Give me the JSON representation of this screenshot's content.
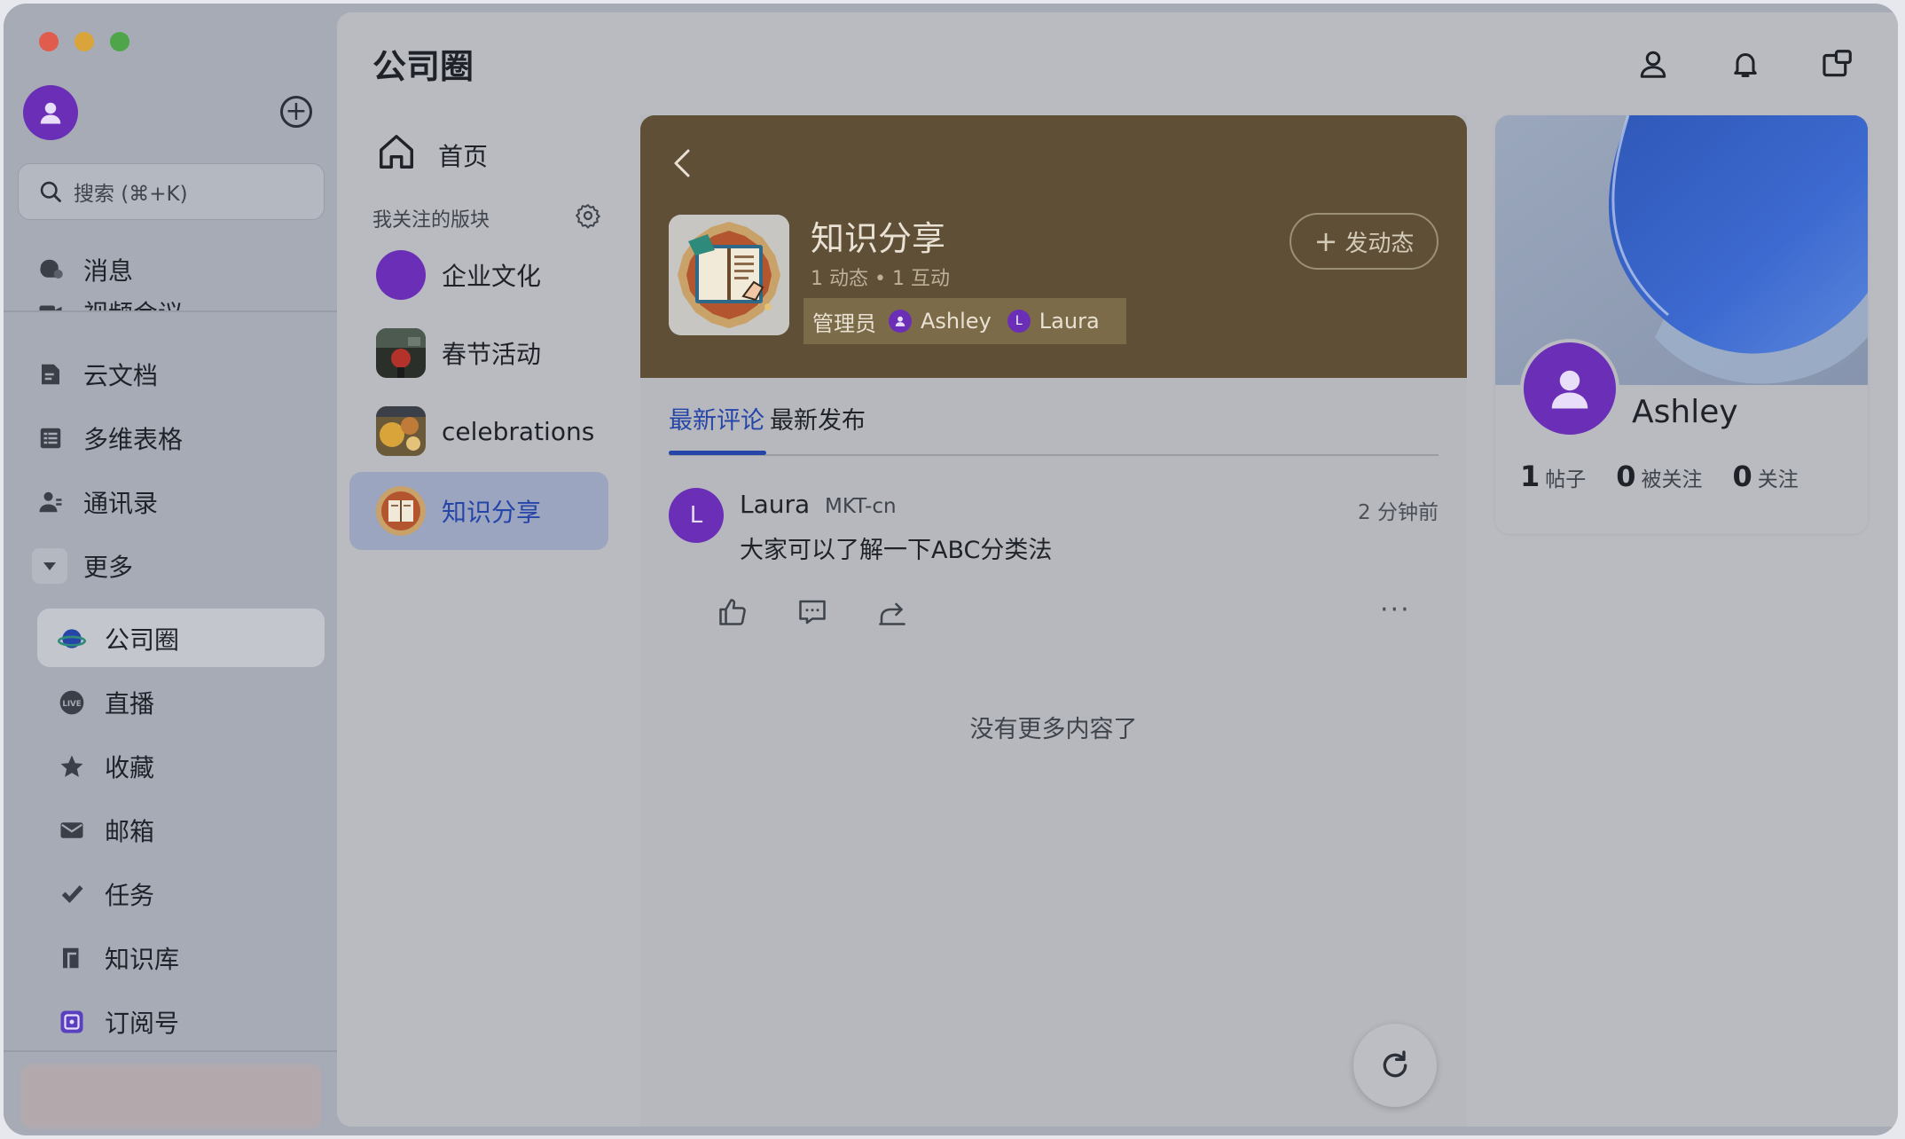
{
  "app": {
    "title": "公司圈"
  },
  "sidebar": {
    "search_placeholder": "搜索 (⌘+K)",
    "items": [
      {
        "label": "消息",
        "icon": "chat-icon"
      },
      {
        "label": "视频会议",
        "icon": "video-icon"
      },
      {
        "label": "云文档",
        "icon": "doc-icon"
      },
      {
        "label": "多维表格",
        "icon": "table-icon"
      },
      {
        "label": "通讯录",
        "icon": "contacts-icon"
      },
      {
        "label": "更多",
        "icon": "chevron-down-icon"
      }
    ],
    "sub_items": [
      {
        "label": "公司圈",
        "icon": "planet-icon"
      },
      {
        "label": "直播",
        "icon": "live-icon"
      },
      {
        "label": "收藏",
        "icon": "star-icon"
      },
      {
        "label": "邮箱",
        "icon": "mail-icon"
      },
      {
        "label": "任务",
        "icon": "check-icon"
      },
      {
        "label": "知识库",
        "icon": "book-icon"
      },
      {
        "label": "订阅号",
        "icon": "subscription-icon"
      }
    ],
    "live_badge": "LIVE"
  },
  "nav": {
    "home": "首页",
    "followed_label": "我关注的版块",
    "topics": [
      {
        "label": "企业文化"
      },
      {
        "label": "春节活动"
      },
      {
        "label": "celebrations"
      },
      {
        "label": "知识分享"
      }
    ]
  },
  "group": {
    "name": "知识分享",
    "stats": "1 动态 • 1 互动",
    "admin_label": "管理员",
    "admins": [
      "Ashley",
      "Laura"
    ],
    "admin_initial_2": "L",
    "post_button": "发动态"
  },
  "tabs": [
    "最新评论",
    "最新发布"
  ],
  "comment": {
    "initial": "L",
    "name": "Laura",
    "dept": "MKT-cn",
    "time": "2 分钟前",
    "text": "大家可以了解一下ABC分类法",
    "more": "···"
  },
  "no_more": "没有更多内容了",
  "profile": {
    "name": "Ashley",
    "stats": [
      {
        "value": "1",
        "label": "帖子"
      },
      {
        "value": "0",
        "label": "被关注"
      },
      {
        "value": "0",
        "label": "关注"
      }
    ]
  },
  "colors": {
    "accent": "#2546a8",
    "avatar": "#6a2fb6",
    "banner": "#5e4f36"
  }
}
